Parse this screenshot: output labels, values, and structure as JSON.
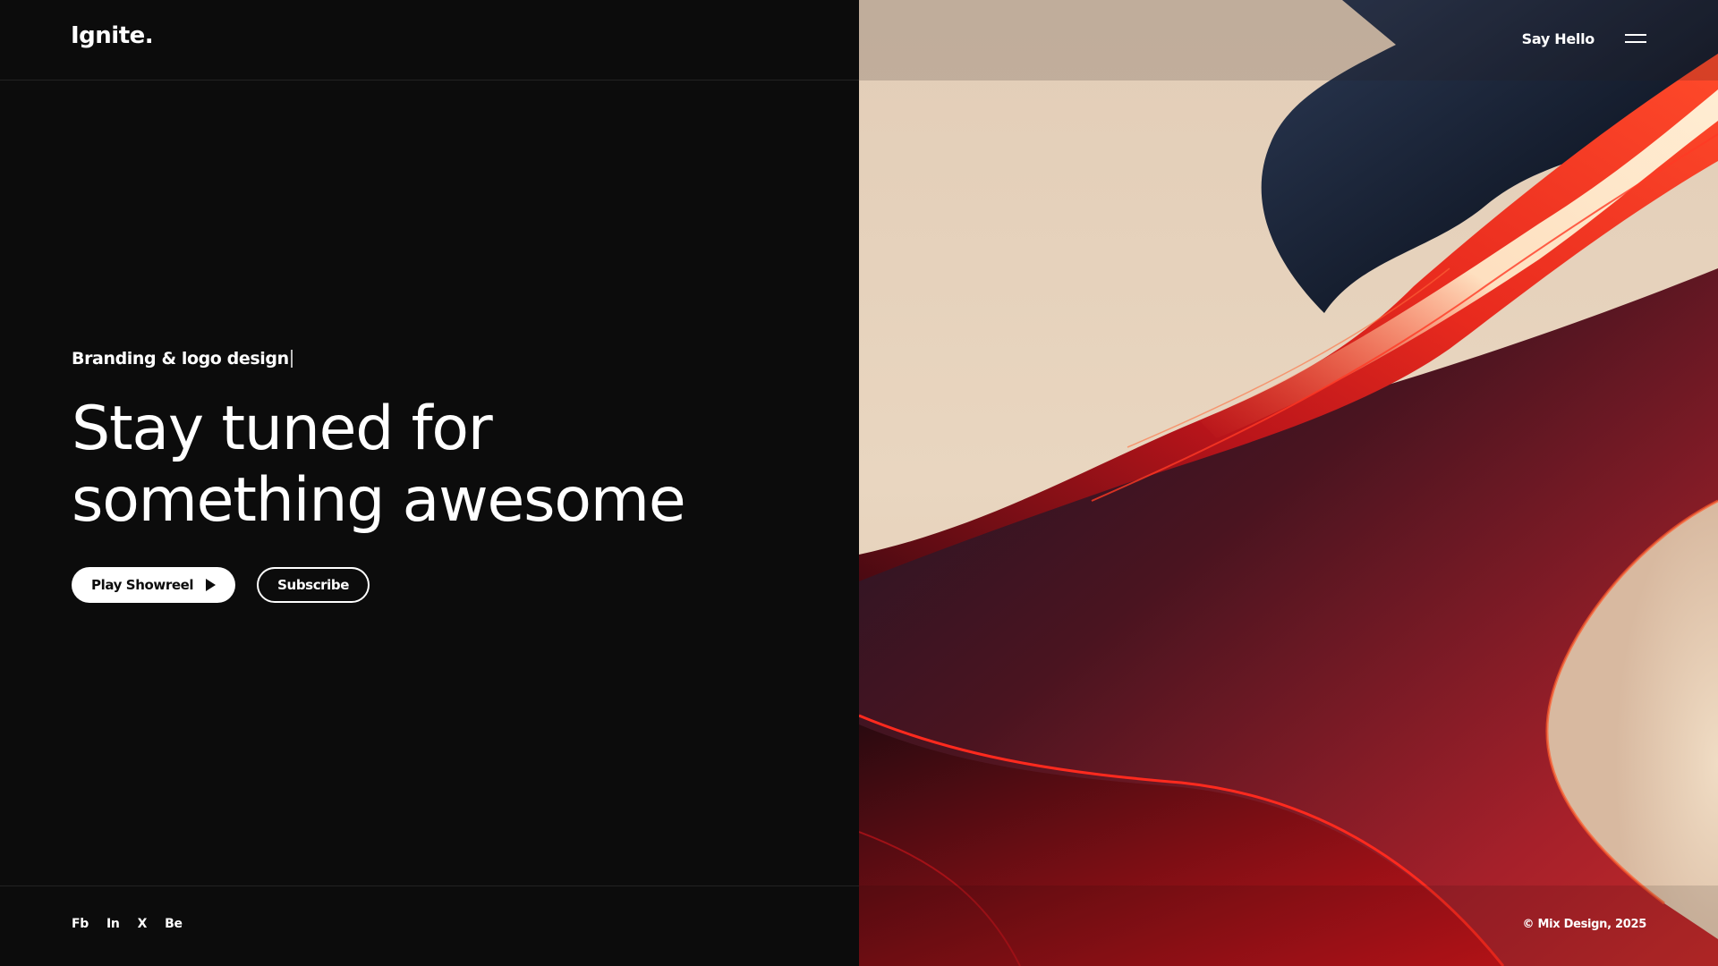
{
  "header": {
    "logo": "Ignite.",
    "say_hello": "Say Hello",
    "menu_icon": "hamburger-menu-icon"
  },
  "hero": {
    "eyebrow": "Branding & logo design",
    "headline_line1": "Stay tuned for",
    "headline_line2": "something awesome",
    "showreel_label": "Play Showreel",
    "showreel_icon": "play-icon",
    "subscribe_label": "Subscribe"
  },
  "footer": {
    "social": [
      "Fb",
      "In",
      "X",
      "Be"
    ],
    "copyright": "© Mix Design, 2025"
  },
  "colors": {
    "background": "#0c0c0c",
    "text": "#ffffff",
    "art_red": "#d8201a",
    "art_navy": "#1c2438",
    "art_cream": "#e6d2bd"
  }
}
